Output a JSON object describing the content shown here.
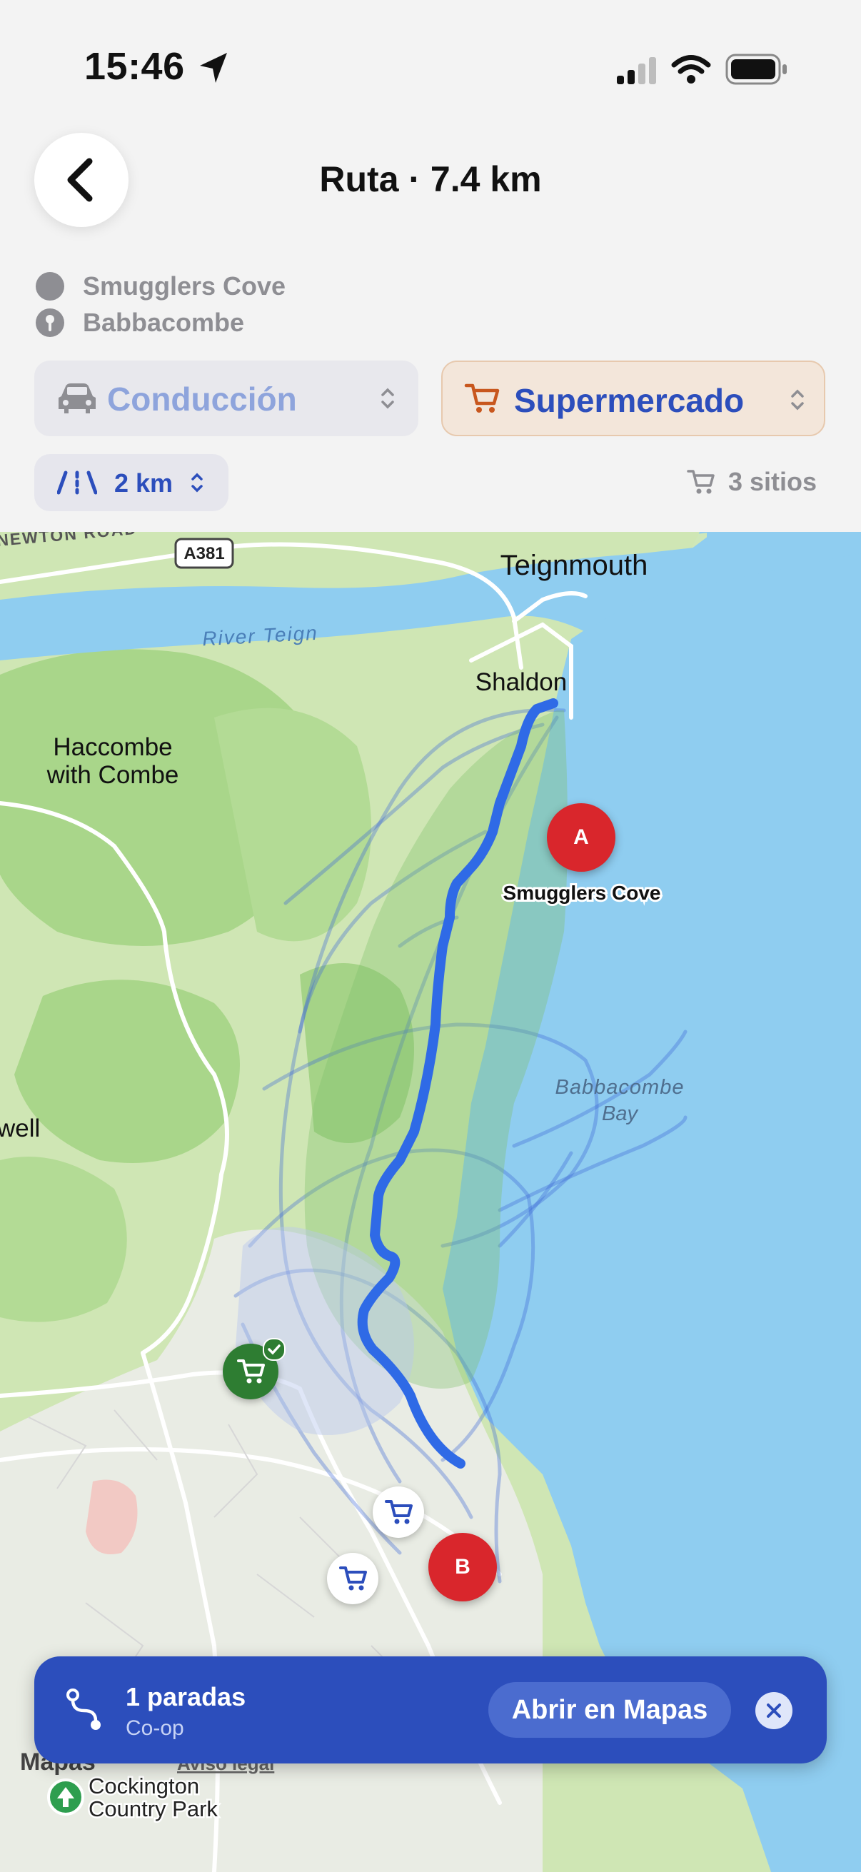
{
  "status_bar": {
    "time": "15:46"
  },
  "header": {
    "title": "Ruta · 7.4 km"
  },
  "route_endpoints": {
    "origin": "Smugglers Cove",
    "destination": "Babbacombe"
  },
  "filters": {
    "mode": {
      "label": "Conducción"
    },
    "category": {
      "label": "Supermercado"
    },
    "distance": {
      "label": "2 km"
    },
    "sites_count": "3 sitios"
  },
  "map": {
    "labels": {
      "road_newton": "NEWTON ROAD",
      "road_a381": "A381",
      "teignmouth": "Teignmouth",
      "river_teign": "River Teign",
      "shaldon": "Shaldon",
      "haccombe_1": "Haccombe",
      "haccombe_2": "with Combe",
      "smugglers_cove": "Smugglers Cove",
      "babbacombe_bay_1": "Babbacombe",
      "babbacombe_bay_2": "Bay",
      "edge_left": "well",
      "attribution": "Mapas",
      "legal": "Aviso legal",
      "cockington_1": "Cockington",
      "cockington_2": "Country Park"
    },
    "markers": {
      "start": "A",
      "end": "B"
    }
  },
  "bottom_bar": {
    "stops": "1 paradas",
    "store": "Co-op",
    "open_button": "Abrir en Mapas"
  },
  "colors": {
    "accent": "#2c4ebc",
    "route": "#2f6ae6",
    "marker_red": "#d9262c",
    "category_orange": "#c8571e",
    "marker_green": "#2e7d32"
  }
}
